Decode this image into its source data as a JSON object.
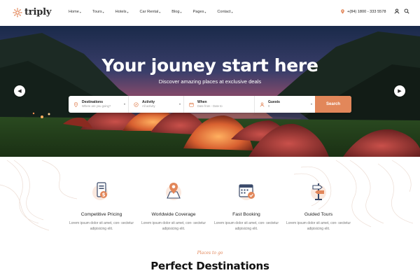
{
  "brand": {
    "name": "triply",
    "accent": "#e2875a"
  },
  "nav": {
    "items": [
      {
        "label": "Home"
      },
      {
        "label": "Tours"
      },
      {
        "label": "Hotels"
      },
      {
        "label": "Car Rental"
      },
      {
        "label": "Blog"
      },
      {
        "label": "Pages"
      },
      {
        "label": "Contact"
      }
    ],
    "phone": "+(84) 1800 - 333 5578",
    "icons": [
      "phone-icon",
      "user-icon",
      "search-icon"
    ]
  },
  "hero": {
    "title": "Your jouney start here",
    "subtitle": "Discover amazing places at exclusive deals",
    "prev_icon": "chevron-left-icon",
    "next_icon": "chevron-right-icon"
  },
  "search": {
    "fields": [
      {
        "label": "Destinations",
        "placeholder": "Where are you going?",
        "icon": "map-pin-icon"
      },
      {
        "label": "Activity",
        "placeholder": "All activity",
        "icon": "compass-icon"
      },
      {
        "label": "When",
        "placeholder": "Date from - Date to",
        "icon": "calendar-icon"
      },
      {
        "label": "Guests",
        "placeholder": "0",
        "icon": "user-icon"
      }
    ],
    "button": "Search"
  },
  "features": [
    {
      "title": "Competitive Pricing",
      "desc": "Lorem ipsum dolor sit amet, con- sectetur adipisicing elit.",
      "icon": "price-tag-icon"
    },
    {
      "title": "Worldwide Coverage",
      "desc": "Lorem ipsum dolor sit amet, con- sectetur adipisicing elit.",
      "icon": "map-icon"
    },
    {
      "title": "Fast Booking",
      "desc": "Lorem ipsum dolor sit amet, con- sectetur adipisicing elit.",
      "icon": "booking-calendar-icon"
    },
    {
      "title": "Guided Tours",
      "desc": "Lorem ipsum dolor sit amet, con- sectetur adipisicing elit.",
      "icon": "signpost-icon"
    }
  ],
  "section": {
    "eyebrow": "Places to go",
    "title": "Perfect Destinations"
  }
}
